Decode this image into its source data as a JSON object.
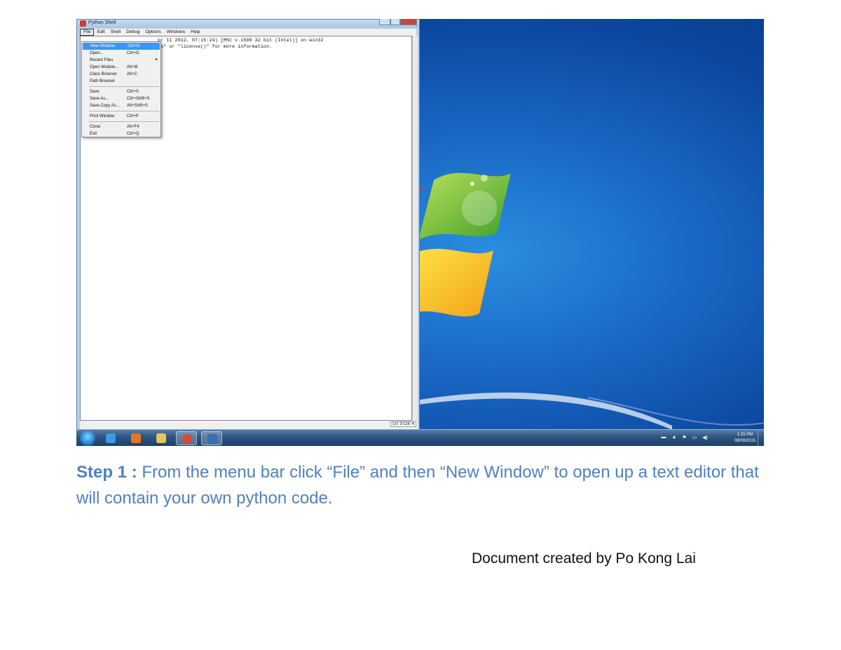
{
  "window": {
    "title": "Python Shell",
    "menu": [
      "File",
      "Edit",
      "Shell",
      "Debug",
      "Options",
      "Windows",
      "Help"
    ],
    "active_menu": "File"
  },
  "editor": {
    "lines": [
      "pr 11 2012, 07:15:24) [MSC v.1500 32 bit (Intel)] on win32",
      "ts\" or \"license()\" for more information."
    ]
  },
  "status": {
    "position": "Ln: 3 Col: 4"
  },
  "file_menu": {
    "items": [
      {
        "label": "New Window",
        "shortcut": "Ctrl+N",
        "highlighted": true
      },
      {
        "label": "Open...",
        "shortcut": "Ctrl+O"
      },
      {
        "label": "Recent Files",
        "shortcut": "",
        "submenu": true
      },
      {
        "label": "Open Module...",
        "shortcut": "Alt+M"
      },
      {
        "label": "Class Browser",
        "shortcut": "Alt+C"
      },
      {
        "label": "Path Browser",
        "shortcut": ""
      },
      {
        "separator": true
      },
      {
        "label": "Save",
        "shortcut": "Ctrl+S"
      },
      {
        "label": "Save As...",
        "shortcut": "Ctrl+Shift+S"
      },
      {
        "label": "Save Copy As...",
        "shortcut": "Alt+Shift+S"
      },
      {
        "separator": true
      },
      {
        "label": "Print Window",
        "shortcut": "Ctrl+P"
      },
      {
        "separator": true
      },
      {
        "label": "Close",
        "shortcut": "Alt+F4"
      },
      {
        "label": "Exit",
        "shortcut": "Ctrl+Q"
      }
    ]
  },
  "taskbar": {
    "apps": [
      {
        "name": "internet-explorer-icon",
        "color": "#3a9be0"
      },
      {
        "name": "media-player-icon",
        "color": "#e8761e"
      },
      {
        "name": "file-explorer-icon",
        "color": "#e8c45a"
      },
      {
        "name": "chrome-icon",
        "color": "#d64a3a"
      },
      {
        "name": "python-icon",
        "color": "#3a6fb0"
      }
    ],
    "clock": {
      "time": "1:15 PM",
      "date": "08/09/2015"
    }
  },
  "caption": {
    "step_label": "Step 1 :",
    "text": " From the menu bar click “File” and then “New Window” to open up a text editor that will contain your own python code."
  },
  "author": "Document created by Po Kong Lai",
  "colors": {
    "caption": "#4f81bd",
    "highlight": "#3399ff"
  }
}
